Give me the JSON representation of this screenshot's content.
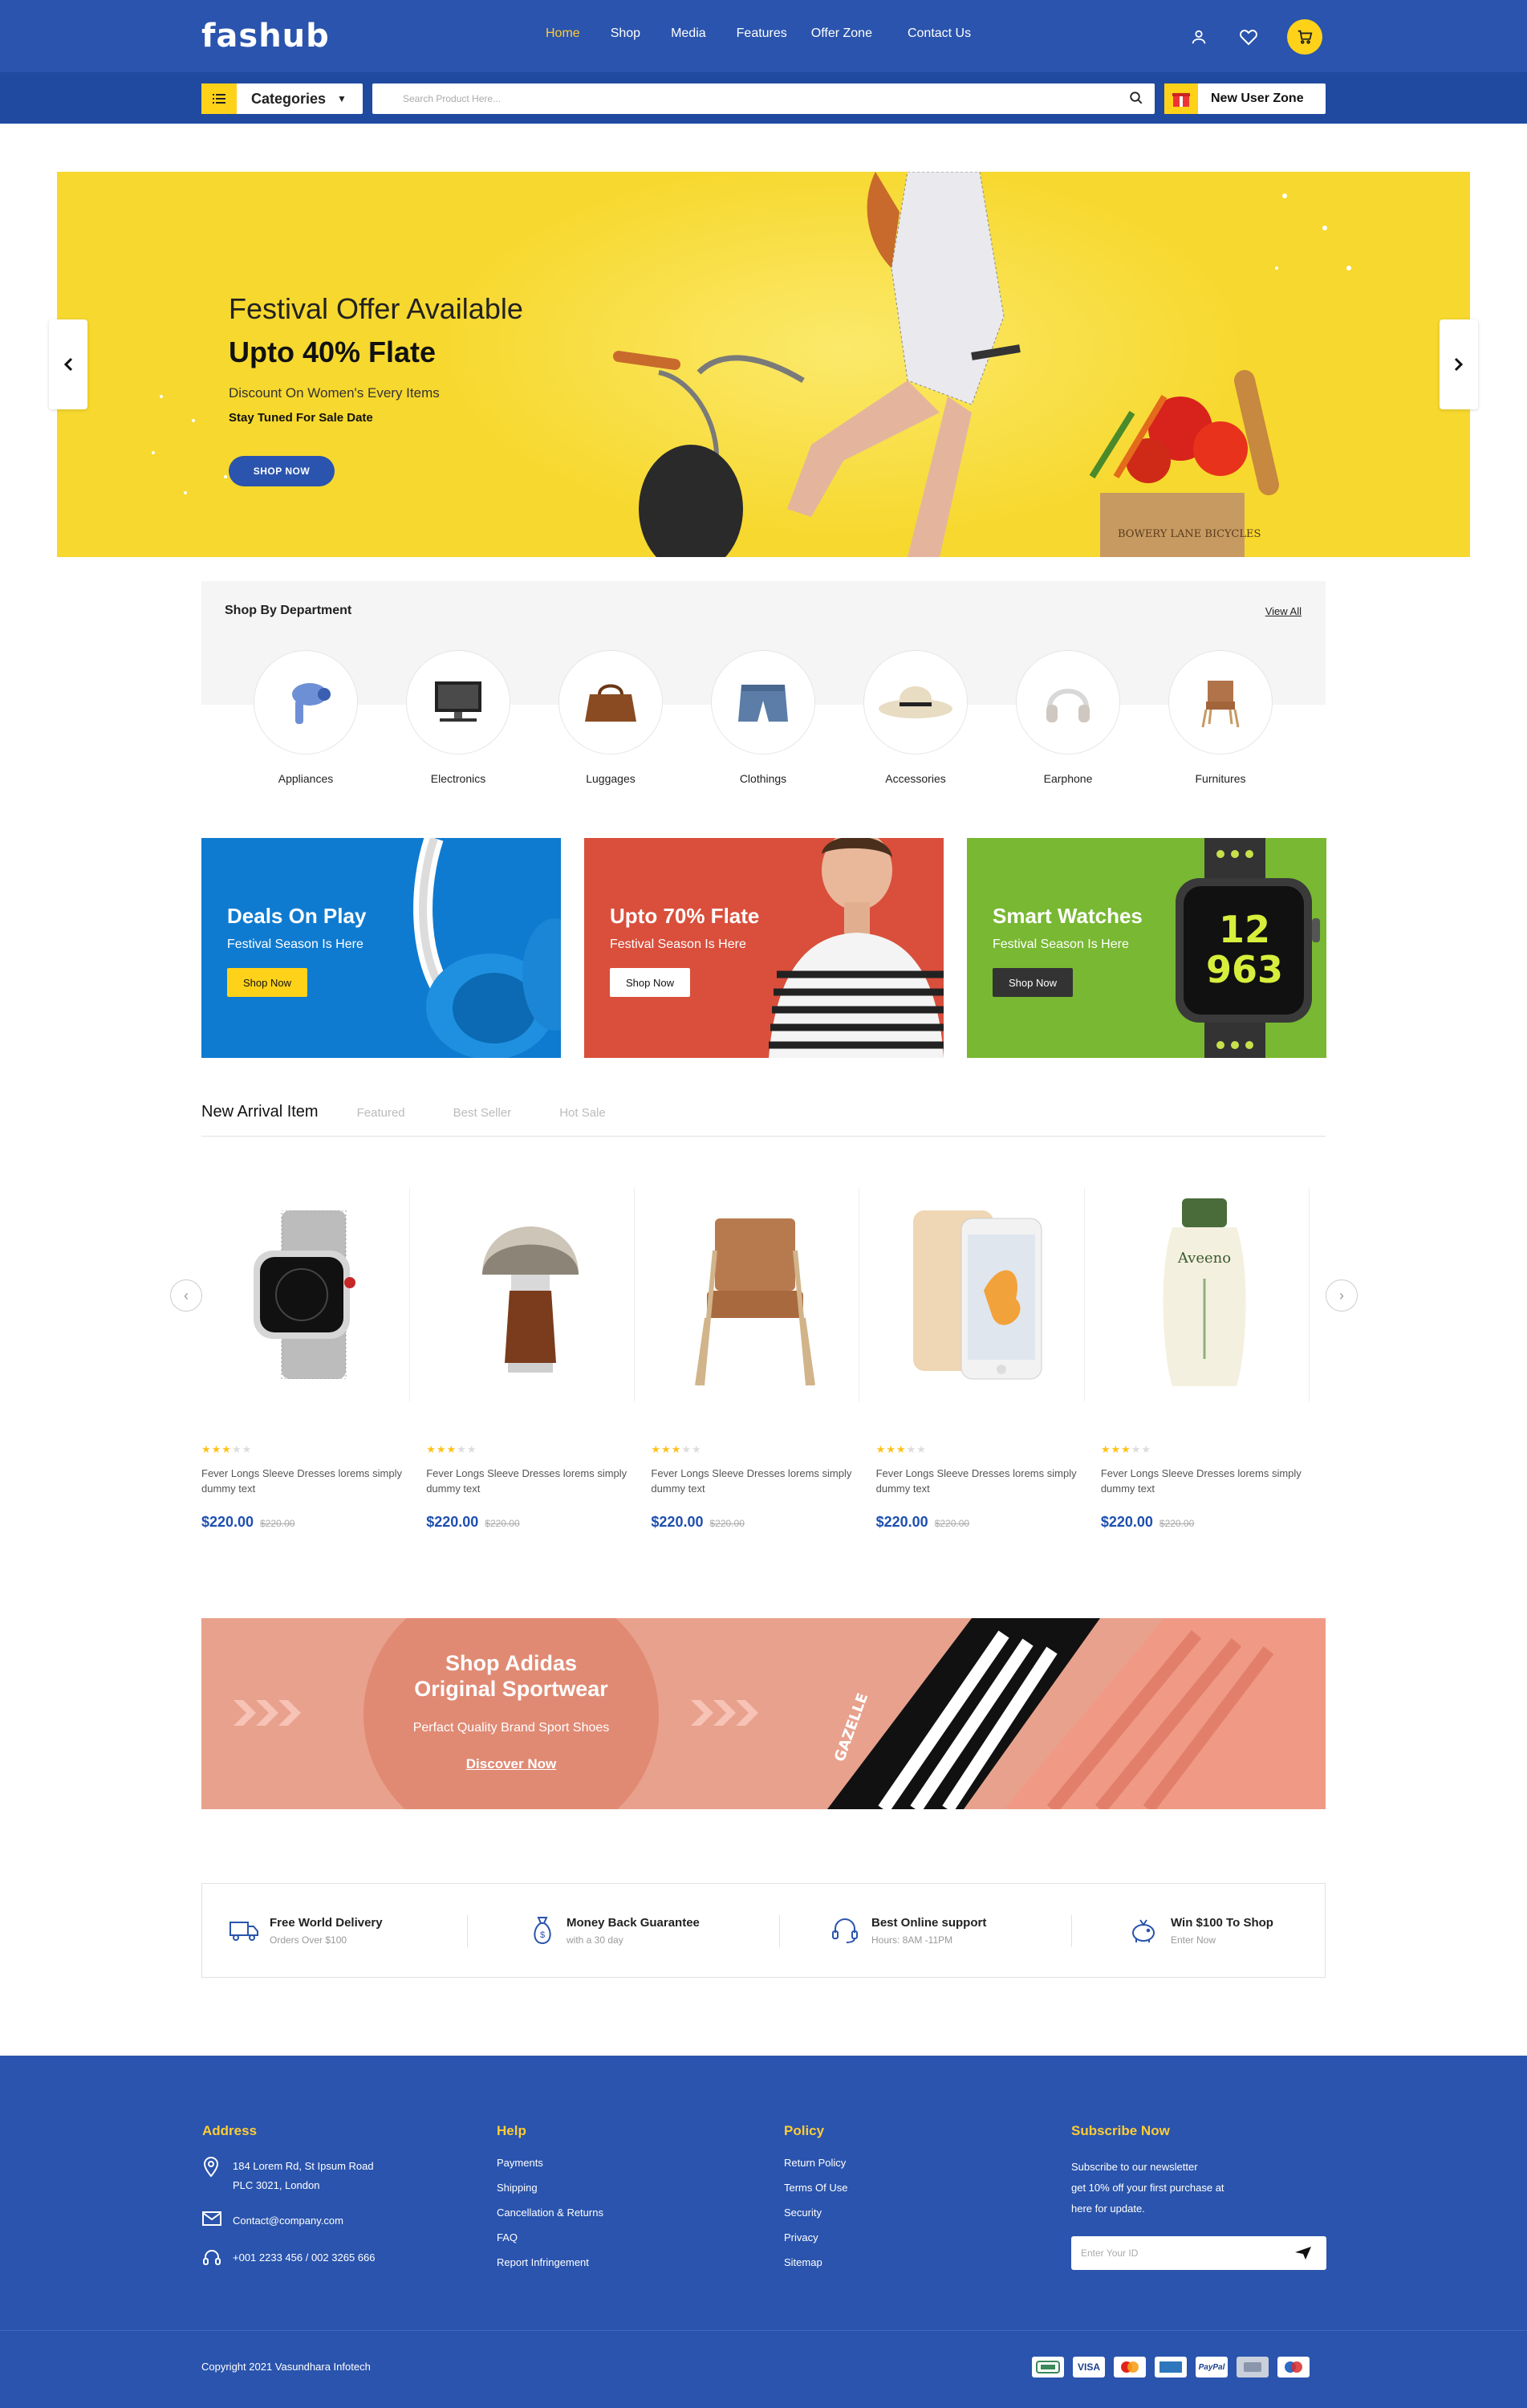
{
  "header": {
    "logo": "fashub",
    "nav": [
      {
        "label": "Home",
        "active": true
      },
      {
        "label": "Shop"
      },
      {
        "label": "Media"
      },
      {
        "label": "Features"
      },
      {
        "label": "Offer Zone"
      },
      {
        "label": "Contact Us"
      }
    ],
    "icons": [
      "user-icon",
      "heart-icon",
      "cart-icon"
    ]
  },
  "subbar": {
    "categories_label": "Categories",
    "search_placeholder": "Search Product Here...",
    "new_user_zone": "New User Zone"
  },
  "hero": {
    "title": "Festival Offer Available",
    "headline": "Upto 40% Flate",
    "subtitle": "Discount On Women's Every Items",
    "tagline": "Stay Tuned For Sale Date",
    "button": "SHOP NOW"
  },
  "department": {
    "title": "Shop By Department",
    "view_all": "View All",
    "items": [
      {
        "label": "Appliances",
        "icon": "hair-dryer-icon"
      },
      {
        "label": "Electronics",
        "icon": "computer-icon"
      },
      {
        "label": "Luggages",
        "icon": "bag-icon"
      },
      {
        "label": "Clothings",
        "icon": "shorts-icon"
      },
      {
        "label": "Accessories",
        "icon": "hat-icon"
      },
      {
        "label": "Earphone",
        "icon": "headphones-icon"
      },
      {
        "label": "Furnitures",
        "icon": "chair-icon"
      }
    ]
  },
  "promos": [
    {
      "title": "Deals On Play",
      "subtitle": "Festival Season Is Here",
      "button": "Shop Now",
      "color": "#0f7bd0"
    },
    {
      "title": "Upto 70% Flate",
      "subtitle": "Festival Season Is Here",
      "button": "Shop Now",
      "color": "#d94f3c"
    },
    {
      "title": "Smart Watches",
      "subtitle": "Festival Season Is Here",
      "button": "Shop Now",
      "color": "#78b832"
    }
  ],
  "tabs": [
    "New Arrival Item",
    "Featured",
    "Best Seller",
    "Hot Sale"
  ],
  "products": [
    {
      "name": "Fever Longs Sleeve Dresses lorems simply dummy text",
      "price": "$220.00",
      "old_price": "$220.00",
      "rating": 3,
      "icon": "smartwatch-icon"
    },
    {
      "name": "Fever Longs Sleeve Dresses lorems simply dummy text",
      "price": "$220.00",
      "old_price": "$220.00",
      "rating": 3,
      "icon": "shaving-brush-icon"
    },
    {
      "name": "Fever Longs Sleeve Dresses lorems simply dummy text",
      "price": "$220.00",
      "old_price": "$220.00",
      "rating": 3,
      "icon": "chair-icon"
    },
    {
      "name": "Fever Longs Sleeve Dresses lorems simply dummy text",
      "price": "$220.00",
      "old_price": "$220.00",
      "rating": 3,
      "icon": "smartphone-icon"
    },
    {
      "name": "Fever Longs Sleeve Dresses lorems simply dummy text",
      "price": "$220.00",
      "old_price": "$220.00",
      "rating": 3,
      "icon": "lotion-bottle-icon"
    }
  ],
  "adidas": {
    "title_line1": "Shop Adidas",
    "title_line2": "Original Sportwear",
    "subtitle": "Perfact Quality Brand Sport Shoes",
    "link": "Discover Now",
    "shoe_text": "GAZELLE"
  },
  "features": [
    {
      "title": "Free World Delivery",
      "sub": "Orders Over $100",
      "icon": "truck-icon"
    },
    {
      "title": "Money Back Guarantee",
      "sub": "with a 30 day",
      "icon": "money-bag-icon"
    },
    {
      "title": "Best Online support",
      "sub": "Hours: 8AM -11PM",
      "icon": "headset-icon"
    },
    {
      "title": "Win $100 To Shop",
      "sub": "Enter Now",
      "icon": "piggy-bank-icon"
    }
  ],
  "footer": {
    "address_title": "Address",
    "address_line1": "184 Lorem Rd, St Ipsum Road",
    "address_line2": "PLC 3021, London",
    "email": "Contact@company.com",
    "phone": "+001 2233 456 / 002 3265 666",
    "help_title": "Help",
    "help_links": [
      "Payments",
      "Shipping",
      "Cancellation & Returns",
      "FAQ",
      "Report Infringement"
    ],
    "policy_title": "Policy",
    "policy_links": [
      "Return Policy",
      "Terms Of Use",
      "Security",
      "Privacy",
      "Sitemap"
    ],
    "subscribe_title": "Subscribe Now",
    "subscribe_text_1": "Subscribe to our newsletter",
    "subscribe_text_2": "get 10% off your first purchase at",
    "subscribe_text_3": "here for update.",
    "subscribe_placeholder": "Enter Your ID",
    "copyright": "Copyright 2021 Vasundhara Infotech",
    "payments": [
      "card-icon",
      "VISA",
      "mastercard-icon",
      "amex-icon",
      "PayPal",
      "discover-icon",
      "maestro-icon"
    ]
  },
  "colors": {
    "primary": "#2a54ad",
    "accent": "#ffd21a",
    "price": "#1e4fb0"
  }
}
